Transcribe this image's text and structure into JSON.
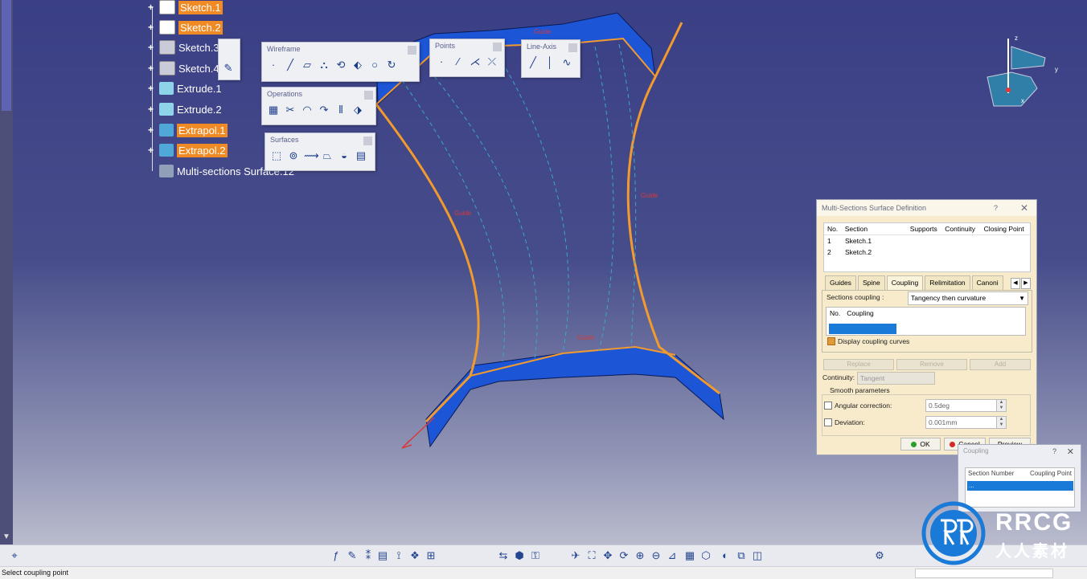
{
  "tree": {
    "items": [
      {
        "label": "Sketch.1",
        "highlight": true,
        "icon": "sketch-icon"
      },
      {
        "label": "Sketch.2",
        "highlight": true,
        "icon": "sketch-icon"
      },
      {
        "label": "Sketch.3",
        "highlight": false,
        "icon": "sketch-icon"
      },
      {
        "label": "Sketch.4",
        "highlight": false,
        "icon": "sketch-icon"
      },
      {
        "label": "Extrude.1",
        "highlight": false,
        "icon": "extrude-icon"
      },
      {
        "label": "Extrude.2",
        "highlight": false,
        "icon": "extrude-icon"
      },
      {
        "label": "Extrapol.1",
        "highlight": true,
        "icon": "extrapol-icon"
      },
      {
        "label": "Extrapol.2",
        "highlight": true,
        "icon": "extrapol-icon"
      },
      {
        "label": "Multi-sections Surface.12",
        "highlight": false,
        "icon": "multisection-icon"
      }
    ],
    "highlight_color": "#f08a24"
  },
  "toolbars": {
    "wireframe": "Wireframe",
    "points": "Points",
    "line_axis": "Line-Axis",
    "operations": "Operations",
    "surfaces": "Surfaces"
  },
  "viewport": {
    "curve_labels": [
      "Guide",
      "Guide",
      "Guide",
      "Guide"
    ],
    "surface_color": "#1c55d6",
    "curve_color": "#f29a2e",
    "compass_axes": [
      "z",
      "y",
      "x"
    ]
  },
  "dialog": {
    "title": "Multi-Sections Surface Definition",
    "help": "?",
    "close": "✕",
    "table_headers": [
      "No.",
      "Section",
      "Supports",
      "Continuity",
      "Closing Point"
    ],
    "rows": [
      {
        "no": "1",
        "section": "Sketch.1"
      },
      {
        "no": "2",
        "section": "Sketch.2"
      }
    ],
    "tabs": [
      "Guides",
      "Spine",
      "Coupling",
      "Relimitation",
      "Canoni"
    ],
    "active_tab": "Coupling",
    "sections_coupling_label": "Sections coupling :",
    "sections_coupling_value": "Tangency then curvature",
    "coupling_headers": [
      "No.",
      "Coupling"
    ],
    "display_coupling_label": "Display coupling curves",
    "display_coupling_checked": true,
    "buttons": {
      "replace": "Replace",
      "remove": "Remove",
      "add": "Add"
    },
    "continuity_label": "Continuity:",
    "continuity_value": "Tangent",
    "smooth_title": "Smooth parameters",
    "angular_label": "Angular correction:",
    "angular_value": "0.5deg",
    "deviation_label": "Deviation:",
    "deviation_value": "0.001mm",
    "ok": "OK",
    "cancel": "Cancel",
    "preview": "Preview"
  },
  "coupling_dialog": {
    "title": "Coupling",
    "help": "?",
    "close": "✕",
    "headers": [
      "Section Number",
      "Coupling Point"
    ],
    "selected": "..."
  },
  "status": {
    "text": "Select coupling point"
  },
  "logo": {
    "text": "RRCG",
    "subtext": "人人素材"
  }
}
